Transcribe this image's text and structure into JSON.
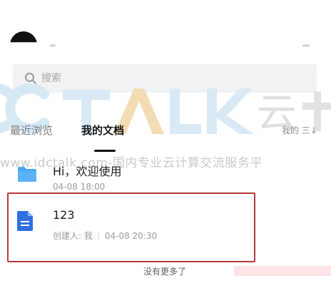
{
  "search": {
    "placeholder": "搜索"
  },
  "tabs": {
    "recent": "最近浏览",
    "mine": "我的文档"
  },
  "sort": {
    "label": "我的 三↓"
  },
  "watermark": {
    "brand_cloud": "云",
    "url_text": "www.idctalk.com-国内专业云计算交流服务平"
  },
  "items": [
    {
      "title": "Hi，欢迎使用",
      "meta": "04-08 18:00",
      "icon": "folder-icon"
    },
    {
      "title": "123",
      "creator": "创建人: 我",
      "time": "04-08 20:30",
      "icon": "document-icon"
    }
  ],
  "footer": {
    "text": "没有更多了"
  },
  "colors": {
    "highlight_border": "#b8393d",
    "folder": "#4aa8f2",
    "document": "#2f6fe0",
    "watermark": "#c9c9c9"
  }
}
